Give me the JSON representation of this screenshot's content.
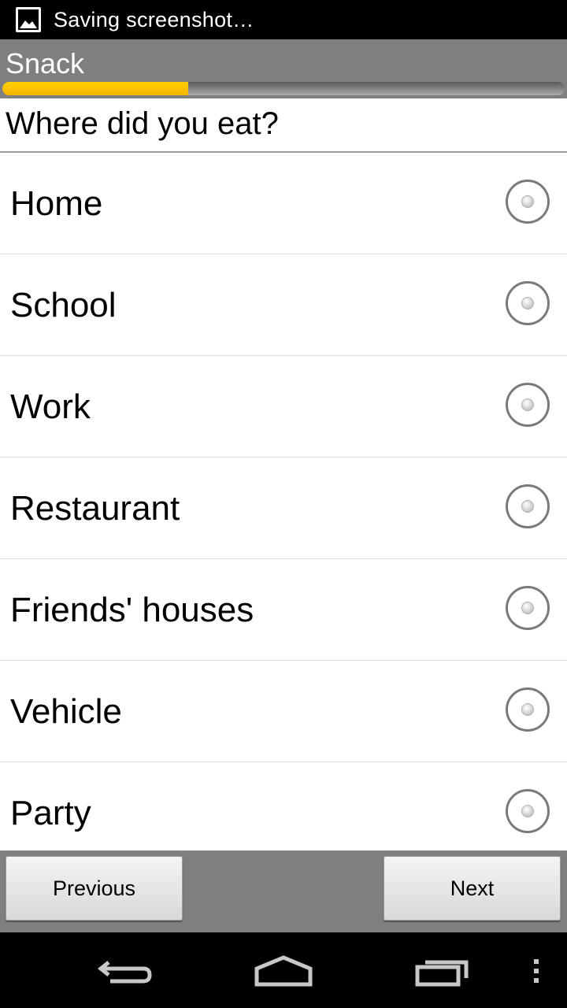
{
  "status_bar": {
    "notification_icon": "image-icon",
    "notification_text": "Saving screenshot…"
  },
  "header": {
    "title": "Snack",
    "progress_fraction": 0.33,
    "progress_color": "#f5b400"
  },
  "question": {
    "text": "Where did you eat?"
  },
  "options": [
    {
      "label": "Home",
      "selected": false
    },
    {
      "label": "School",
      "selected": false
    },
    {
      "label": "Work",
      "selected": false
    },
    {
      "label": "Restaurant",
      "selected": false
    },
    {
      "label": "Friends' houses",
      "selected": false
    },
    {
      "label": "Vehicle",
      "selected": false
    },
    {
      "label": "Party",
      "selected": false
    }
  ],
  "navigation": {
    "previous_label": "Previous",
    "next_label": "Next"
  },
  "system_nav": {
    "back_icon": "back-arrow-icon",
    "home_icon": "home-icon",
    "recents_icon": "recent-apps-icon",
    "menu_icon": "overflow-menu-icon"
  }
}
